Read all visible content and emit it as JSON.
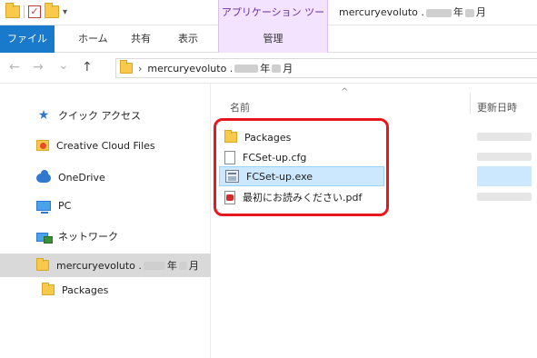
{
  "colors": {
    "accent": "#1979ca",
    "apptab": "#f3e3ff",
    "selected_row": "#cce8ff",
    "highlight": "#e8161d"
  },
  "titlebar": {
    "quick_access": [
      "folder-icon",
      "check-icon",
      "folder-icon",
      "dropdown-icon"
    ],
    "app_tab": "アプリケーション ツール",
    "window_title_prefix": "mercuryevoluto .",
    "window_title_year": "年",
    "window_title_month": "月"
  },
  "ribbon": {
    "file": "ファイル",
    "home": "ホーム",
    "share": "共有",
    "view": "表示",
    "manage": "管理"
  },
  "address": {
    "nav_back": "←",
    "nav_forward": "→",
    "nav_recent": "⌄",
    "nav_up": "↑",
    "crumb_arrow": "›",
    "crumb_prefix": "mercuryevoluto .",
    "crumb_year": "年",
    "crumb_month": "月"
  },
  "sidebar": {
    "items": [
      {
        "label": "クイック アクセス",
        "icon": "star-icon"
      },
      {
        "label": "Creative Cloud Files",
        "icon": "creative-cloud-icon"
      },
      {
        "label": "OneDrive",
        "icon": "onedrive-icon"
      },
      {
        "label": "PC",
        "icon": "pc-icon"
      },
      {
        "label": "ネットワーク",
        "icon": "network-icon"
      },
      {
        "label_prefix": "mercuryevoluto .",
        "label_year": "年",
        "label_month": "月",
        "icon": "folder-icon"
      },
      {
        "label": "Packages",
        "icon": "folder-icon"
      }
    ]
  },
  "content": {
    "col_name": "名前",
    "col_date": "更新日時",
    "sort_indicator": "^",
    "files": [
      {
        "name": "Packages",
        "type": "folder"
      },
      {
        "name": "FCSet-up.cfg",
        "type": "document"
      },
      {
        "name": "FCSet-up.exe",
        "type": "executable"
      },
      {
        "name": "最初にお読みください.pdf",
        "type": "pdf"
      }
    ]
  }
}
